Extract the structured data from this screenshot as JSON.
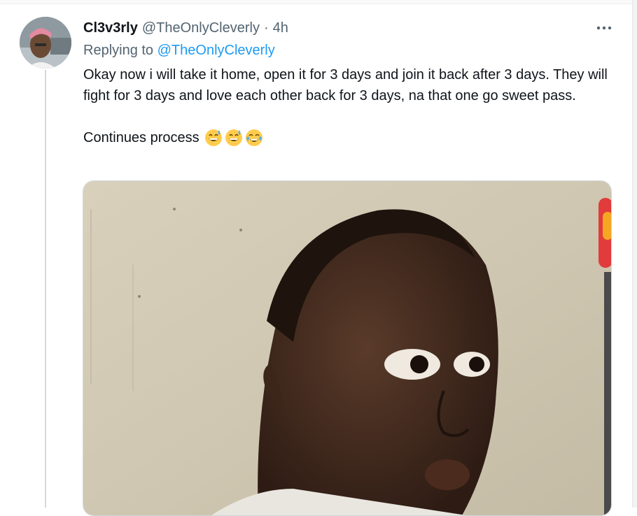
{
  "tweet": {
    "display_name": "Cl3v3rly",
    "handle": "@TheOnlyCleverly",
    "separator": "·",
    "time": "4h",
    "replying_to_label": "Replying to",
    "replying_to_handle": "@TheOnlyCleverly",
    "text_paragraph_1": "Okay now i will take it home, open it for 3 days and join it back after 3 days. They will fight for 3 days and love each other back for 3 days, na that one go sweet pass.",
    "text_paragraph_2": "Continues process",
    "emojis": [
      "grinning-face-with-sweat",
      "grinning-face-with-sweat",
      "face-with-tears-of-joy"
    ]
  },
  "icons": {
    "more": "more-horizontal-icon"
  },
  "colors": {
    "primary_text": "#0f1419",
    "secondary_text": "#536471",
    "link": "#1d9bf0",
    "thread_line": "#cfd9de"
  }
}
